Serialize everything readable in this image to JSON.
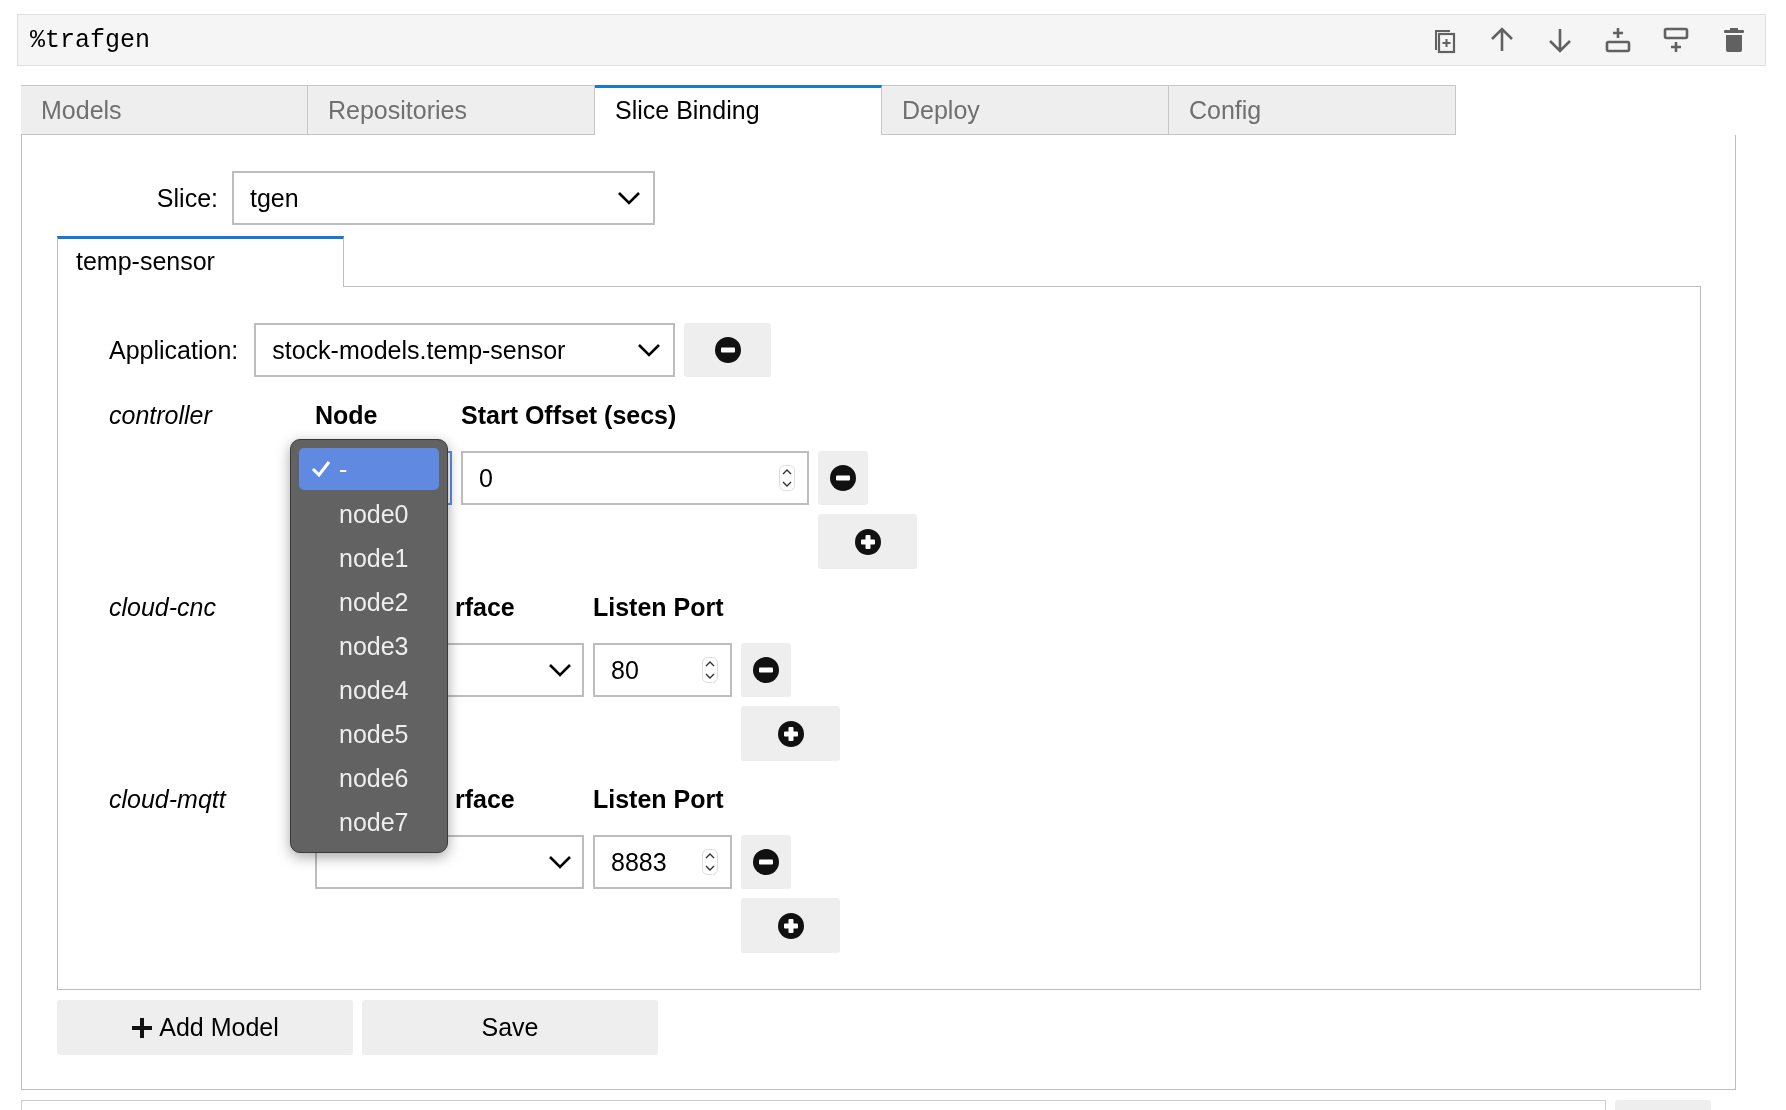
{
  "cell": {
    "source": "%trafgen"
  },
  "tabs": [
    {
      "label": "Models",
      "selected": false
    },
    {
      "label": "Repositories",
      "selected": false
    },
    {
      "label": "Slice Binding",
      "selected": true
    },
    {
      "label": "Deploy",
      "selected": false
    },
    {
      "label": "Config",
      "selected": false
    }
  ],
  "slice": {
    "label": "Slice:",
    "value": "tgen"
  },
  "model_tabs": [
    {
      "label": "temp-sensor",
      "selected": true
    }
  ],
  "application": {
    "label": "Application:",
    "value": "stock-models.temp-sensor"
  },
  "services": [
    {
      "name": "controller",
      "kind": "node",
      "headers": [
        "Node",
        "Start Offset (secs)"
      ],
      "value": "0",
      "options": [
        {
          "label": "-",
          "selected": true
        },
        {
          "label": "node0",
          "selected": false
        },
        {
          "label": "node1",
          "selected": false
        },
        {
          "label": "node2",
          "selected": false
        },
        {
          "label": "node3",
          "selected": false
        },
        {
          "label": "node4",
          "selected": false
        },
        {
          "label": "node5",
          "selected": false
        },
        {
          "label": "node6",
          "selected": false
        },
        {
          "label": "node7",
          "selected": false
        }
      ]
    },
    {
      "name": "cloud-cnc",
      "kind": "interface",
      "headers": [
        "rface",
        "Listen Port"
      ],
      "value": "80"
    },
    {
      "name": "cloud-mqtt",
      "kind": "interface",
      "headers": [
        "rface",
        "Listen Port"
      ],
      "value": "8883"
    }
  ],
  "buttons": [
    {
      "label": "Add Model",
      "kind": "add"
    },
    {
      "label": "Save",
      "kind": "plain"
    }
  ]
}
